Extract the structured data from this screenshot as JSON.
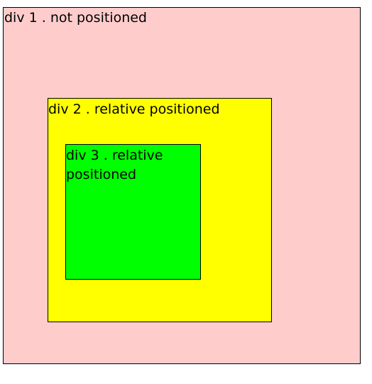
{
  "boxes": {
    "div1": {
      "label": "div 1 . not positioned",
      "background": "#ffcccc"
    },
    "div2": {
      "label": "div 2 . relative positioned",
      "background": "#ffff00"
    },
    "div3": {
      "label": "div 3 . relative positioned",
      "background": "#00ff00"
    }
  },
  "colors": {
    "page_background": "#ffffff",
    "border": "#000000",
    "text": "#000000"
  }
}
